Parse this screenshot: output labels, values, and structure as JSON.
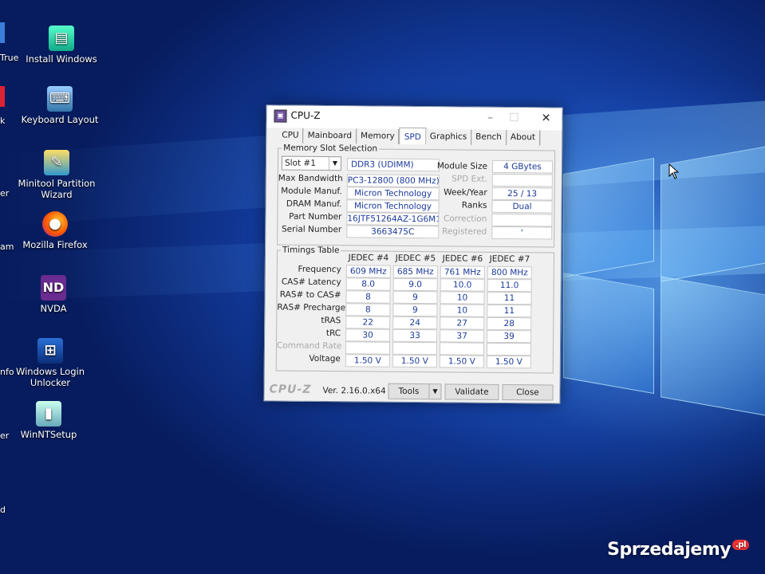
{
  "desktop": {
    "icons": [
      {
        "label": "Install Windows",
        "icon": "install-windows-icon"
      },
      {
        "label": "Keyboard Layout",
        "icon": "keyboard-icon"
      },
      {
        "label": "Minitool Partition Wizard",
        "icon": "partition-icon"
      },
      {
        "label": "Mozilla Firefox",
        "icon": "firefox-icon"
      },
      {
        "label": "NVDA",
        "icon": "nvda-icon"
      },
      {
        "label": "Windows Login Unlocker",
        "icon": "unlocker-icon"
      },
      {
        "label": "WinNTSetup",
        "icon": "winntsetup-icon"
      }
    ],
    "edge_labels": [
      "True",
      "k",
      "er",
      "am",
      "nfo",
      "er",
      "d"
    ]
  },
  "window": {
    "title": "CPU-Z",
    "tabs": [
      "CPU",
      "Mainboard",
      "Memory",
      "SPD",
      "Graphics",
      "Bench",
      "About"
    ],
    "active_tab": "SPD",
    "slot_group": {
      "title": "Memory Slot Selection",
      "slot": "Slot #1",
      "type": "DDR3 (UDIMM)",
      "rows": [
        {
          "label": "Max Bandwidth",
          "value": "PC3-12800 (800 MHz)"
        },
        {
          "label": "Module Manuf.",
          "value": "Micron Technology"
        },
        {
          "label": "DRAM Manuf.",
          "value": "Micron Technology"
        },
        {
          "label": "Part Number",
          "value": "16JTF51264AZ-1G6M1"
        },
        {
          "label": "Serial Number",
          "value": "3663475C"
        }
      ],
      "right": [
        {
          "label": "Module Size",
          "value": "4 GBytes",
          "dim": false
        },
        {
          "label": "SPD Ext.",
          "value": "",
          "dim": true
        },
        {
          "label": "Week/Year",
          "value": "25 / 13",
          "dim": false
        },
        {
          "label": "Ranks",
          "value": "Dual",
          "dim": false
        },
        {
          "label": "Correction",
          "value": "",
          "dim": true
        },
        {
          "label": "Registered",
          "value": "'",
          "dim": true
        }
      ]
    },
    "timings": {
      "title": "Timings Table",
      "columns": [
        "JEDEC #4",
        "JEDEC #5",
        "JEDEC #6",
        "JEDEC #7"
      ],
      "rows": [
        {
          "label": "Frequency",
          "values": [
            "609 MHz",
            "685 MHz",
            "761 MHz",
            "800 MHz"
          ],
          "dim": false
        },
        {
          "label": "CAS# Latency",
          "values": [
            "8.0",
            "9.0",
            "10.0",
            "11.0"
          ],
          "dim": false
        },
        {
          "label": "RAS# to CAS#",
          "values": [
            "8",
            "9",
            "10",
            "11"
          ],
          "dim": false
        },
        {
          "label": "RAS# Precharge",
          "values": [
            "8",
            "9",
            "10",
            "11"
          ],
          "dim": false
        },
        {
          "label": "tRAS",
          "values": [
            "22",
            "24",
            "27",
            "28"
          ],
          "dim": false
        },
        {
          "label": "tRC",
          "values": [
            "30",
            "33",
            "37",
            "39"
          ],
          "dim": false
        },
        {
          "label": "Command Rate",
          "values": [
            "",
            "",
            "",
            ""
          ],
          "dim": true
        },
        {
          "label": "Voltage",
          "values": [
            "1.50 V",
            "1.50 V",
            "1.50 V",
            "1.50 V"
          ],
          "dim": false
        }
      ]
    },
    "footer": {
      "brand": "CPU-Z",
      "version": "Ver. 2.16.0.x64",
      "tools_label": "Tools",
      "validate_label": "Validate",
      "close_label": "Close"
    }
  },
  "watermark": {
    "text": "Sprzedajemy",
    "suffix": ".pl"
  }
}
